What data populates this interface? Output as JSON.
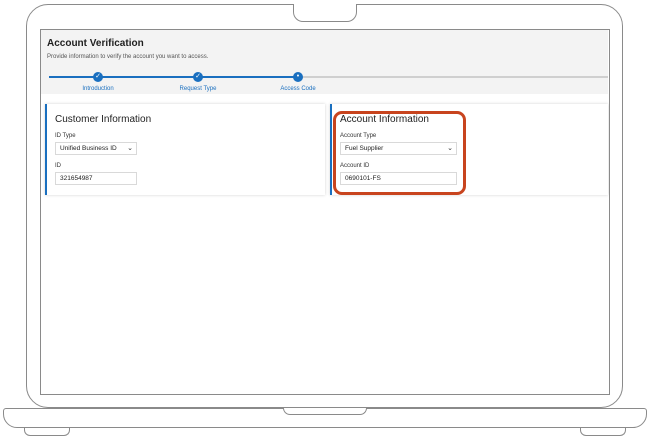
{
  "header": {
    "title": "Account Verification",
    "subtitle": "Provide information to verify the account you want to access."
  },
  "steps": [
    {
      "label": "Introduction",
      "status": "complete",
      "icon": "check-icon"
    },
    {
      "label": "Request Type",
      "status": "complete",
      "icon": "check-icon"
    },
    {
      "label": "Access Code",
      "status": "current",
      "icon": "dot-icon"
    }
  ],
  "step_glyphs": {
    "complete": "✓",
    "current": "•"
  },
  "customer": {
    "title": "Customer Information",
    "id_type_label": "ID Type",
    "id_type_value": "Unified Business ID",
    "id_label": "ID",
    "id_value": "321654987"
  },
  "account": {
    "title": "Account Information",
    "account_type_label": "Account Type",
    "account_type_value": "Fuel Supplier",
    "account_id_label": "Account ID",
    "account_id_value": "0690101-FS"
  },
  "colors": {
    "accent": "#1a6fbf",
    "highlight": "#c8441e"
  }
}
